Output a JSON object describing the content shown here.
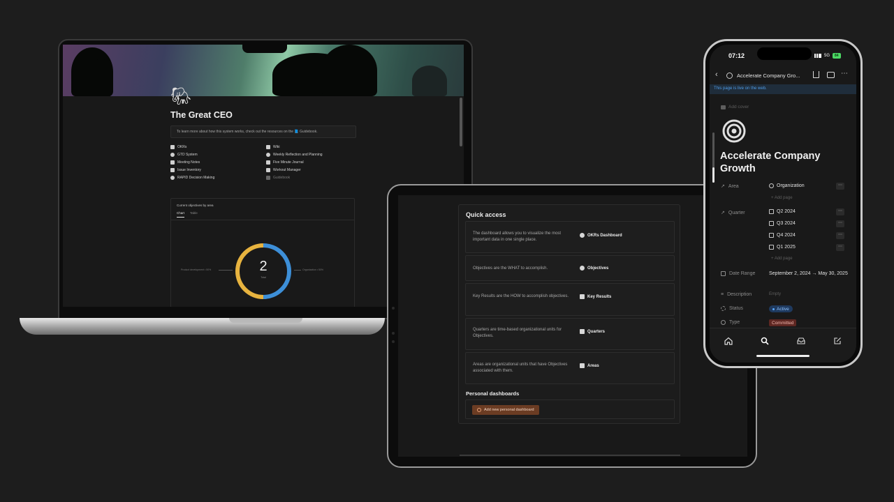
{
  "laptop": {
    "page_title": "The Great CEO",
    "callout": "To learn more about how this system works, check out the resources on the 📘 Guidebook.",
    "links_left": [
      "OKRs",
      "GTD System",
      "Meeting Notes",
      "Issue Inventory",
      "RAPID Decision Making"
    ],
    "links_right": [
      "Wiki",
      "Weekly Reflection and Planning",
      "Five Minute Journal",
      "Workout Manager",
      "Guidebook"
    ],
    "objectives": {
      "title": "Current objectives by area",
      "tabs": [
        "Chart",
        "Table"
      ],
      "donut_value": "2",
      "donut_label": "Total",
      "legend_left": "Product development • 50%",
      "legend_right": "Organization • 50%"
    }
  },
  "tablet": {
    "quick_access_title": "Quick access",
    "rows": [
      {
        "desc": "The dashboard allows you to visualize the most important data in one single place.",
        "link": "OKRs Dashboard"
      },
      {
        "desc": "Objectives are the WHAT to accomplish.",
        "link": "Objectives"
      },
      {
        "desc": "Key Results are the HOW to accomplish objectives.",
        "link": "Key Results"
      },
      {
        "desc": "Quarters are time-based organizational units for Objectives.",
        "link": "Quarters"
      },
      {
        "desc": "Areas are organizational units that have Objectives associated with them.",
        "link": "Areas"
      }
    ],
    "personal_title": "Personal dashboards",
    "add_button": "Add new personal dashboard"
  },
  "phone": {
    "time": "07:12",
    "network": "5G",
    "battery": "84",
    "nav_title": "Accelerate Company Gro...",
    "live_banner": "This page is live on the web.",
    "add_cover": "Add cover",
    "title": "Accelerate Company Growth",
    "props": {
      "area_label": "Area",
      "area_value": "Organization",
      "add_page": "Add page",
      "quarter_label": "Quarter",
      "quarters": [
        "Q2 2024",
        "Q3 2024",
        "Q4 2024",
        "Q1 2025"
      ],
      "date_label": "Date Range",
      "date_value": "September 2, 2024 → May 30, 2025",
      "desc_label": "Description",
      "desc_value": "Empty",
      "status_label": "Status",
      "status_value": "Active",
      "type_label": "Type",
      "type_value": "Committed"
    },
    "colors": {
      "live_banner": "#4e9be6",
      "active_tag": "#1f3a5f",
      "committed_tag": "#5e2722"
    }
  },
  "colors": {
    "donut_yellow": "#e7b33f",
    "donut_blue": "#3d8fd8",
    "add_button": "#6b3c23"
  }
}
